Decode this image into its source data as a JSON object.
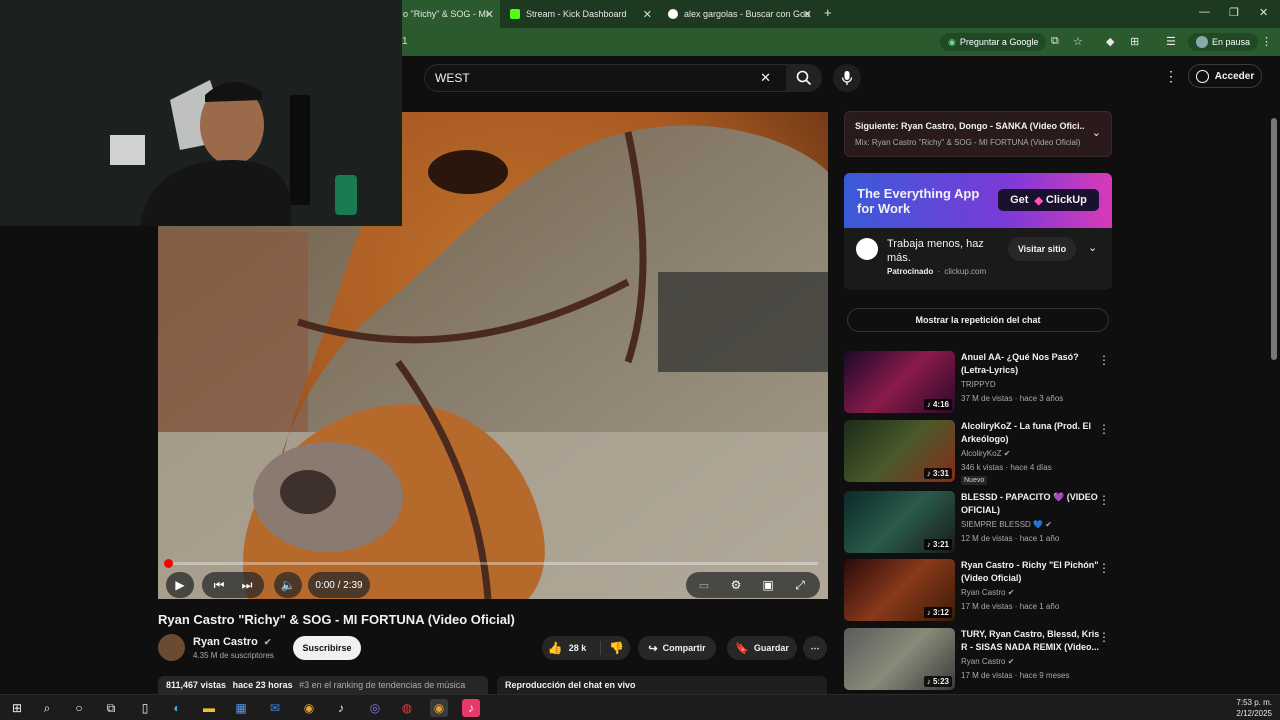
{
  "browser": {
    "tabs": [
      {
        "label": "o \"Richy\" & SOG - MI",
        "active": true
      },
      {
        "label": "Stream - Kick Dashboard",
        "active": false
      },
      {
        "label": "alex gargolas - Buscar con Goo",
        "active": false
      }
    ],
    "new_tab": "+",
    "address_fragment": "1",
    "ask_google": "Preguntar a Google",
    "profile_status": "En pausa",
    "colors": {
      "frame": "#1d3a20",
      "toolbar": "#2b5a2f"
    }
  },
  "youtube": {
    "search": {
      "value": "WEST"
    },
    "signin_label": "Acceder",
    "player": {
      "time": "0:00 / 2:39"
    },
    "video": {
      "title": "Ryan Castro \"Richy\" & SOG - MI FORTUNA (Video Oficial)",
      "channel": "Ryan Castro",
      "subscribers": "4.35 M de suscriptores",
      "subscribe_label": "Suscribirse",
      "likes": "28 k",
      "share_label": "Compartir",
      "save_label": "Guardar",
      "views": "811,467 vistas",
      "age": "hace 23 horas",
      "trending": "#3 en el ranking de tendencias de música",
      "chat_replay_header": "Reproducción del chat en vivo"
    },
    "up_next": {
      "title": "Siguiente: Ryan Castro, Dongo - SANKA (Video Ofici...",
      "subtitle": "Mix: Ryan Castro \"Richy\" & SOG - MI FORTUNA (Video Oficial)"
    },
    "ad": {
      "banner_line1": "The Everything App",
      "banner_line2": "for Work",
      "banner_cta": "Get",
      "banner_brand": "ClickUp",
      "text": "Trabaja menos, haz más.",
      "sponsored": "Patrocinado",
      "domain": "clickup.com",
      "visit_label": "Visitar sitio"
    },
    "chat_replay_button": "Mostrar la repetición del chat",
    "recommendations": [
      {
        "title": "Anuel AA- ¿Qué Nos Pasó? (Letra-Lyrics)",
        "channel": "TRIPPYD",
        "meta": "37 M de vistas · hace 3 años",
        "duration": "4:16",
        "color": "#6a1a3a"
      },
      {
        "title": "AlcoliryKoZ - La funa (Prod. El Arkeólogo)",
        "channel": "AlcoliryKoZ",
        "meta": "346 k vistas · hace 4 días",
        "duration": "3:31",
        "badge": "Nuevo",
        "color": "#3a5a2a"
      },
      {
        "title": "BLESSD - PAPACITO 💜 (VIDEO OFICIAL)",
        "channel": "SIEMPRE BLESSD 💙",
        "meta": "12 M de vistas · hace 1 año",
        "duration": "3:21",
        "color": "#2a4a3a"
      },
      {
        "title": "Ryan Castro - Richy \"El Pichón\" (Video Oficial)",
        "channel": "Ryan Castro",
        "meta": "17 M de vistas · hace 1 año",
        "duration": "3:12",
        "color": "#5a2a1a"
      },
      {
        "title": "TURY, Ryan Castro, Blessd, Kris R - SISAS NADA REMIX (Video...",
        "channel": "Ryan Castro",
        "meta": "17 M de vistas · hace 9 meses",
        "duration": "5:23",
        "color": "#4a4a4a"
      }
    ]
  },
  "taskbar": {
    "time": "7:53 p. m.",
    "date": "2/12/2025"
  }
}
